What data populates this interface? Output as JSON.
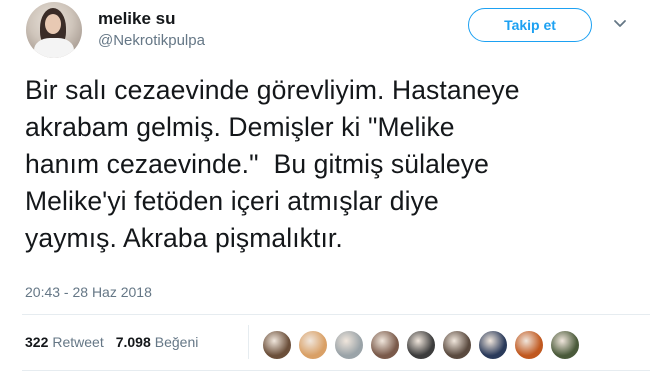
{
  "user": {
    "name": "melike su",
    "handle": "@Nekrotikpulpa",
    "follow_label": "Takip et"
  },
  "tweet": {
    "text": "Bir salı cezaevinde görevliyim. Hastaneye\nakrabam gelmiş. Demişler ki \"Melike\nhanım cezaevinde.\"  Bu gitmiş sülaleye\nMelike'yi fetöden içeri atmışlar diye\nyaymış. Akraba pişmalıktır.",
    "timestamp": "20:43 - 28 Haz 2018"
  },
  "stats": {
    "retweets_count": "322",
    "retweets_label": "Retweet",
    "likes_count": "7.098",
    "likes_label": "Beğeni"
  },
  "likers": [
    {
      "color": "#6b4f3a"
    },
    {
      "color": "#d9a066"
    },
    {
      "color": "#9aa3a8"
    },
    {
      "color": "#7a5a4a"
    },
    {
      "color": "#3c3c3c"
    },
    {
      "color": "#5a4a3f"
    },
    {
      "color": "#2a3a5a"
    },
    {
      "color": "#c0581f"
    },
    {
      "color": "#4a5a3a"
    }
  ],
  "colors": {
    "accent": "#1da1f2",
    "muted": "#657786",
    "text": "#14171a"
  },
  "icons": {
    "menu": "chevron-down-icon"
  }
}
